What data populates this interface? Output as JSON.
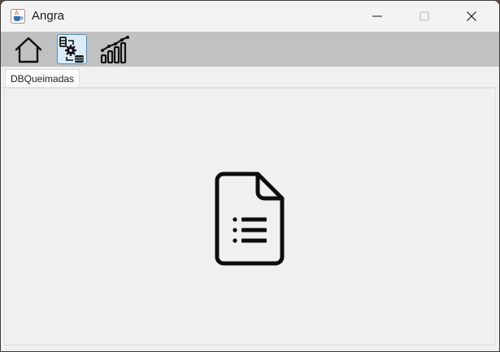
{
  "window": {
    "title": "Angra",
    "app_icon": "java-coffee-icon",
    "controls": [
      "minimize-icon",
      "maximize-icon",
      "close-icon"
    ]
  },
  "toolbar": {
    "buttons": [
      {
        "icon": "home-icon",
        "selected": false
      },
      {
        "icon": "database-settings-icon",
        "selected": true
      },
      {
        "icon": "growth-chart-icon",
        "selected": false
      }
    ]
  },
  "tabs": [
    {
      "label": "DBQueimadas",
      "active": true
    }
  ],
  "content": {
    "icon": "document-list-icon"
  },
  "colors": {
    "toolbar_bg": "#c1c1c1",
    "selected_border": "#4b90cf",
    "window_bg": "#f0f0f0"
  }
}
